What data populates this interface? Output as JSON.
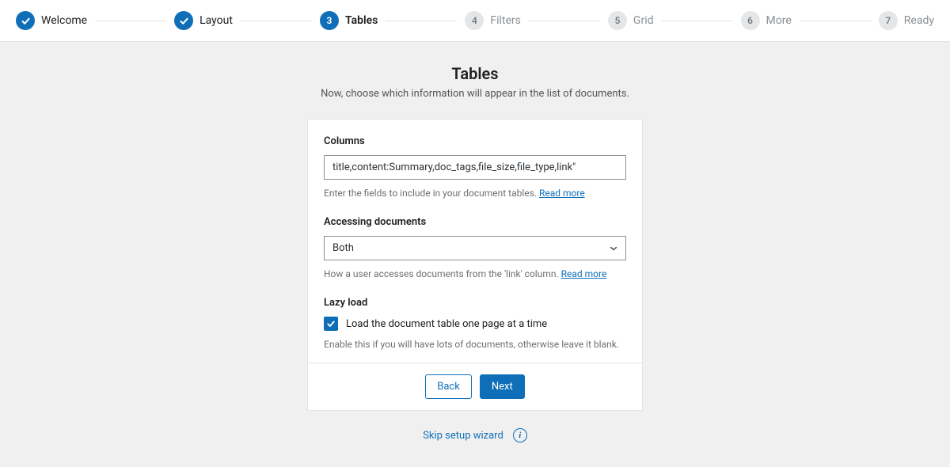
{
  "colors": {
    "primary": "#0e6fb8",
    "muted": "#8a8f94",
    "border": "#e3e3e3"
  },
  "stepper": {
    "steps": [
      {
        "label": "Welcome",
        "state": "done"
      },
      {
        "label": "Layout",
        "state": "done"
      },
      {
        "label": "Tables",
        "state": "active",
        "number": "3"
      },
      {
        "label": "Filters",
        "state": "future",
        "number": "4"
      },
      {
        "label": "Grid",
        "state": "future",
        "number": "5"
      },
      {
        "label": "More",
        "state": "future",
        "number": "6"
      },
      {
        "label": "Ready",
        "state": "future",
        "number": "7"
      }
    ]
  },
  "heading": {
    "title": "Tables",
    "subtitle": "Now, choose which information will appear in the list of documents."
  },
  "form": {
    "columns": {
      "label": "Columns",
      "value": "title,content:Summary,doc_tags,file_size,file_type,link\"",
      "help_prefix": "Enter the fields to include in your document tables. ",
      "help_link": "Read more"
    },
    "access": {
      "label": "Accessing documents",
      "selected": "Both",
      "help_prefix": "How a user accesses documents from the 'link' column. ",
      "help_link": "Read more"
    },
    "lazyload": {
      "label": "Lazy load",
      "checkbox_label": "Load the document table one page at a time",
      "checked": true,
      "help": "Enable this if you will have lots of documents, otherwise leave it blank."
    }
  },
  "footer": {
    "back": "Back",
    "next": "Next",
    "skip": "Skip setup wizard"
  }
}
